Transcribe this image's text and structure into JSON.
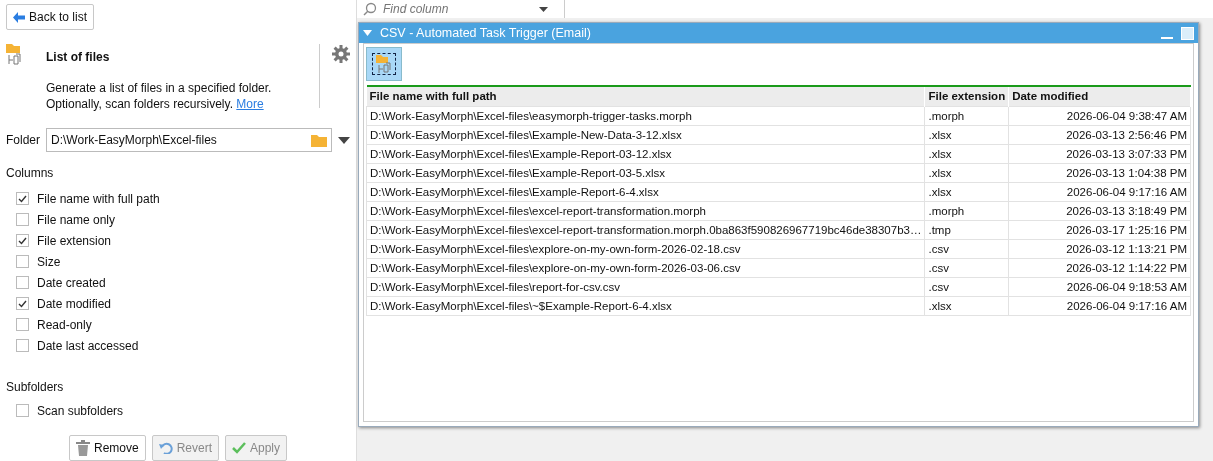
{
  "back_button": {
    "label": "Back to list"
  },
  "step": {
    "title": "List of files",
    "description": "Generate a list of files in a specified folder. Optionally, scan folders recursively.",
    "more_link": "More"
  },
  "folder": {
    "label": "Folder",
    "value": "D:\\Work-EasyMorph\\Excel-files"
  },
  "columns_section": {
    "title": "Columns",
    "options": [
      {
        "label": "File name with full path",
        "checked": true
      },
      {
        "label": "File name only",
        "checked": false
      },
      {
        "label": "File extension",
        "checked": true
      },
      {
        "label": "Size",
        "checked": false
      },
      {
        "label": "Date created",
        "checked": false
      },
      {
        "label": "Date modified",
        "checked": true
      },
      {
        "label": "Read-only",
        "checked": false
      },
      {
        "label": "Date last accessed",
        "checked": false
      }
    ]
  },
  "subfolders_section": {
    "title": "Subfolders",
    "options": [
      {
        "label": "Scan subfolders",
        "checked": false
      }
    ]
  },
  "actions": [
    {
      "label": "Remove",
      "kind": "remove",
      "disabled": false
    },
    {
      "label": "Revert",
      "kind": "revert",
      "disabled": true
    },
    {
      "label": "Apply",
      "kind": "apply",
      "disabled": true
    }
  ],
  "find_column": {
    "placeholder": "Find column"
  },
  "table_window": {
    "title": "CSV - Automated Task Trigger (Email)",
    "columns": [
      "File name with full path",
      "File extension",
      "Date modified"
    ],
    "rows": [
      [
        "D:\\Work-EasyMorph\\Excel-files\\easymorph-trigger-tasks.morph",
        ".morph",
        "2026-06-04 9:38:47 AM"
      ],
      [
        "D:\\Work-EasyMorph\\Excel-files\\Example-New-Data-3-12.xlsx",
        ".xlsx",
        "2026-03-13 2:56:46 PM"
      ],
      [
        "D:\\Work-EasyMorph\\Excel-files\\Example-Report-03-12.xlsx",
        ".xlsx",
        "2026-03-13 3:07:33 PM"
      ],
      [
        "D:\\Work-EasyMorph\\Excel-files\\Example-Report-03-5.xlsx",
        ".xlsx",
        "2026-03-13 1:04:38 PM"
      ],
      [
        "D:\\Work-EasyMorph\\Excel-files\\Example-Report-6-4.xlsx",
        ".xlsx",
        "2026-06-04 9:17:16 AM"
      ],
      [
        "D:\\Work-EasyMorph\\Excel-files\\excel-report-transformation.morph",
        ".morph",
        "2026-03-13 3:18:49 PM"
      ],
      [
        "D:\\Work-EasyMorph\\Excel-files\\excel-report-transformation.morph.0ba863f590826967719bc46de38307b3…",
        ".tmp",
        "2026-03-17 1:25:16 PM"
      ],
      [
        "D:\\Work-EasyMorph\\Excel-files\\explore-on-my-own-form-2026-02-18.csv",
        ".csv",
        "2026-03-12 1:13:21 PM"
      ],
      [
        "D:\\Work-EasyMorph\\Excel-files\\explore-on-my-own-form-2026-03-06.csv",
        ".csv",
        "2026-03-12 1:14:22 PM"
      ],
      [
        "D:\\Work-EasyMorph\\Excel-files\\report-for-csv.csv",
        ".csv",
        "2026-06-04 9:18:53 AM"
      ],
      [
        "D:\\Work-EasyMorph\\Excel-files\\~$Example-Report-6-4.xlsx",
        ".xlsx",
        "2026-06-04 9:17:16 AM"
      ]
    ]
  }
}
